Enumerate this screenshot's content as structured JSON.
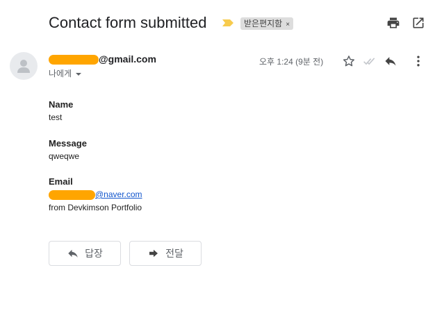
{
  "subject": "Contact form submitted",
  "label_chip": {
    "text": "받은편지함",
    "close": "×"
  },
  "sender": {
    "email_suffix": "@gmail.com",
    "recipient": "나에게"
  },
  "time": "오후 1:24 (9분 전)",
  "body": {
    "name_label": "Name",
    "name_value": "test",
    "message_label": "Message",
    "message_value": "qweqwe",
    "email_label": "Email",
    "email_suffix": "@naver.com",
    "footer": "from Devkimson Portfolio"
  },
  "actions": {
    "reply": "답장",
    "forward": "전달"
  },
  "colors": {
    "redaction": "#ffa500",
    "importance": "#f7cb4d",
    "link": "#1155cc"
  },
  "icons": [
    "importance-marker-icon",
    "print-icon",
    "open-in-new-window-icon",
    "default-avatar-icon",
    "star-icon",
    "read-receipt-icon",
    "reply-icon",
    "more-vert-icon",
    "forward-icon"
  ]
}
